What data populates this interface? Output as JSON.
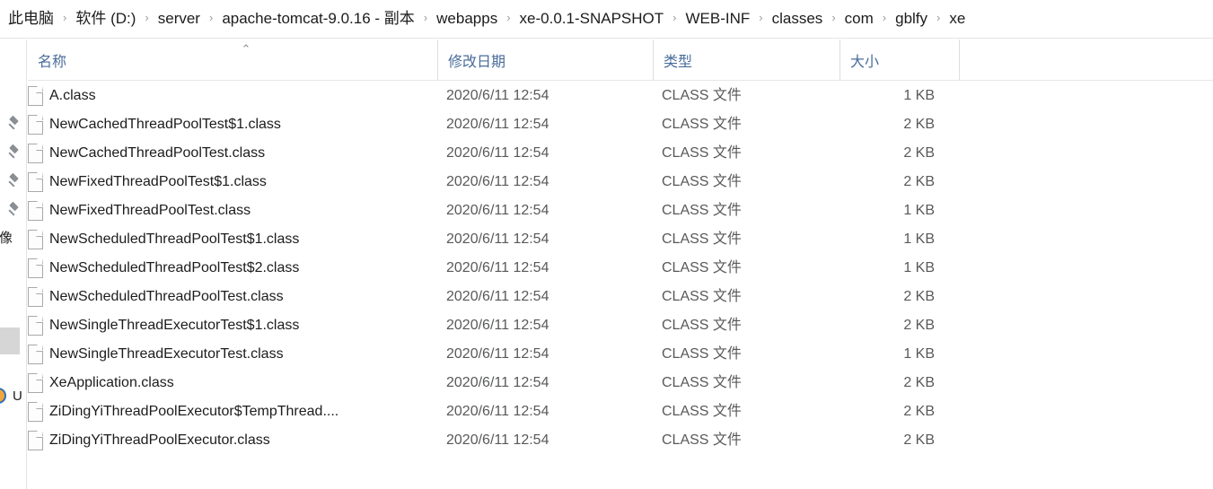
{
  "breadcrumb": {
    "separator": "›",
    "items": [
      "此电脑",
      "软件 (D:)",
      "server",
      "apache-tomcat-9.0.16 - 副本",
      "webapps",
      "xe-0.0.1-SNAPSHOT",
      "WEB-INF",
      "classes",
      "com",
      "gblfy",
      "xe"
    ]
  },
  "nav_pane": {
    "clipped_text": "镜像",
    "drive_label": "U",
    "pin_icon_count": 4
  },
  "columns": {
    "name": "名称",
    "date": "修改日期",
    "type": "类型",
    "size": "大小",
    "sort_caret": "⌃"
  },
  "files": [
    {
      "name": "A.class",
      "date": "2020/6/11 12:54",
      "type": "CLASS 文件",
      "size": "1 KB"
    },
    {
      "name": "NewCachedThreadPoolTest$1.class",
      "date": "2020/6/11 12:54",
      "type": "CLASS 文件",
      "size": "2 KB"
    },
    {
      "name": "NewCachedThreadPoolTest.class",
      "date": "2020/6/11 12:54",
      "type": "CLASS 文件",
      "size": "2 KB"
    },
    {
      "name": "NewFixedThreadPoolTest$1.class",
      "date": "2020/6/11 12:54",
      "type": "CLASS 文件",
      "size": "2 KB"
    },
    {
      "name": "NewFixedThreadPoolTest.class",
      "date": "2020/6/11 12:54",
      "type": "CLASS 文件",
      "size": "1 KB"
    },
    {
      "name": "NewScheduledThreadPoolTest$1.class",
      "date": "2020/6/11 12:54",
      "type": "CLASS 文件",
      "size": "1 KB"
    },
    {
      "name": "NewScheduledThreadPoolTest$2.class",
      "date": "2020/6/11 12:54",
      "type": "CLASS 文件",
      "size": "1 KB"
    },
    {
      "name": "NewScheduledThreadPoolTest.class",
      "date": "2020/6/11 12:54",
      "type": "CLASS 文件",
      "size": "2 KB"
    },
    {
      "name": "NewSingleThreadExecutorTest$1.class",
      "date": "2020/6/11 12:54",
      "type": "CLASS 文件",
      "size": "2 KB"
    },
    {
      "name": "NewSingleThreadExecutorTest.class",
      "date": "2020/6/11 12:54",
      "type": "CLASS 文件",
      "size": "1 KB"
    },
    {
      "name": "XeApplication.class",
      "date": "2020/6/11 12:54",
      "type": "CLASS 文件",
      "size": "2 KB"
    },
    {
      "name": "ZiDingYiThreadPoolExecutor$TempThread....",
      "date": "2020/6/11 12:54",
      "type": "CLASS 文件",
      "size": "2 KB"
    },
    {
      "name": "ZiDingYiThreadPoolExecutor.class",
      "date": "2020/6/11 12:54",
      "type": "CLASS 文件",
      "size": "2 KB"
    }
  ],
  "colors": {
    "header_text": "#4a6c9b",
    "row_text": "#1c1c1c",
    "secondary_text": "#58595b",
    "divider": "#e3e3e3",
    "selection": "#d6d6d6"
  }
}
